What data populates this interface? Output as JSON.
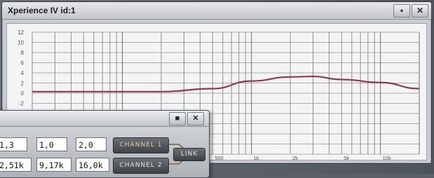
{
  "window": {
    "title": "Xperience IV id:1",
    "btn_min": "•",
    "btn_close": "✕"
  },
  "panel": {
    "btn_min": "■",
    "btn_close": "✕",
    "row1": [
      "1,3",
      "1,0",
      "2,0"
    ],
    "row2": [
      "2,51k",
      "9,17k",
      "16,0k"
    ],
    "channel1": "CHANNEL 1",
    "channel2": "CHANNEL 2",
    "link": "LINK"
  },
  "chart_data": {
    "type": "line",
    "y_ticks": [
      "12",
      "10",
      "8",
      "6",
      "4",
      "2",
      "0",
      "-2"
    ],
    "x_ticks": [
      "500",
      "1k",
      "2k",
      "5k",
      "10k"
    ],
    "x_scale": "log",
    "ylim": [
      -12,
      12
    ],
    "xlim": [
      20,
      20000
    ],
    "grid": true,
    "series": [
      {
        "color": "#8e3a4e",
        "x": [
          20,
          200,
          500,
          1000,
          2000,
          3000,
          5000,
          10000,
          20000
        ],
        "y": [
          0.3,
          0.3,
          0.9,
          2.4,
          3.2,
          3.3,
          2.7,
          2.1,
          0.9
        ]
      }
    ]
  }
}
